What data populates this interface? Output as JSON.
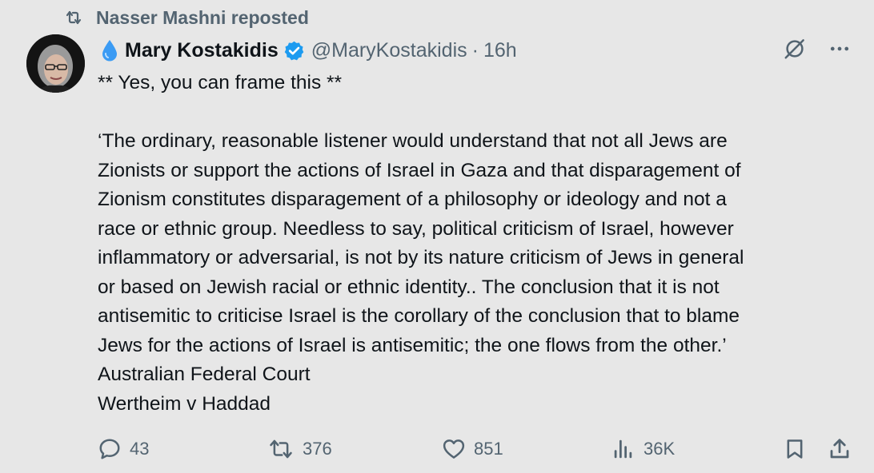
{
  "repost": {
    "icon": "repost-icon",
    "text": "Nasser Mashni reposted"
  },
  "author": {
    "emoji_icon": "droplet-icon",
    "name": "Mary Kostakidis",
    "verified_icon": "verified-badge-icon",
    "handle": "@MaryKostakidis",
    "separator": "·",
    "time": "16h"
  },
  "header_actions": {
    "grok_icon": "grok-icon",
    "more_icon": "more-icon"
  },
  "body": {
    "lines": [
      "** Yes, you can frame this **",
      "",
      "‘The ordinary, reasonable listener would understand that not all Jews are",
      "Zionists or support the actions of Israel in Gaza and that disparagement of",
      "Zionism constitutes disparagement of a philosophy or ideology and not a",
      "race or ethnic group. Needless to say, political criticism of Israel, however",
      "inflammatory or adversarial, is not by its nature criticism of Jews in general",
      "or based on Jewish racial or ethnic identity.. The conclusion that it is not",
      "antisemitic to criticise Israel is the corollary of the conclusion that to blame",
      "Jews for the actions of Israel is antisemitic; the one flows from the other.’",
      "Australian Federal Court",
      "Wertheim v Haddad"
    ]
  },
  "actions": {
    "replies": "43",
    "reposts": "376",
    "likes": "851",
    "views": "36K"
  },
  "colors": {
    "background": "#e7e7e7",
    "text": "#0f1419",
    "muted": "#536471",
    "verified": "#1d9bf0"
  }
}
